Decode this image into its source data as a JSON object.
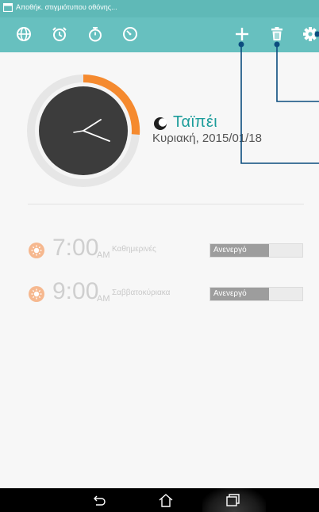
{
  "status_bar": {
    "notification_text": "Αποθήκ. στιγμιότυπου οθόνης..."
  },
  "toolbar": {
    "left_icons": [
      "world-clock-icon",
      "alarm-clock-icon",
      "stopwatch-icon",
      "timer-icon"
    ],
    "right_icons": [
      "add-icon",
      "delete-icon",
      "settings-icon"
    ]
  },
  "world_clock": {
    "city": "Ταϊπέι",
    "date": "Κυριακή, 2015/01/18",
    "is_night": true
  },
  "alarms": [
    {
      "time": "7:00",
      "ampm": "AM",
      "repeat": "Καθημερινές",
      "state_label": "Ανενεργό"
    },
    {
      "time": "9:00",
      "ampm": "AM",
      "repeat": "Σαββατοκύριακα",
      "state_label": "Ανενεργό"
    }
  ],
  "colors": {
    "toolbar": "#67c0bf",
    "accent_teal": "#1b9c9a",
    "clock_arc": "#f58a2f",
    "alarm_icon": "#f6b88f",
    "callout_line": "#0c4d7f"
  }
}
